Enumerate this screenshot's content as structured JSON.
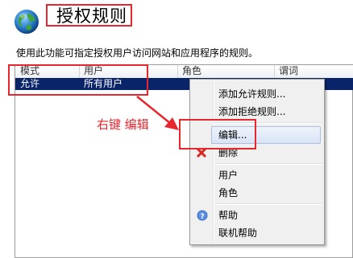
{
  "header": {
    "title": "授权规则"
  },
  "description": "使用此功能可指定授权用户访问网站和应用程序的规则。",
  "grid": {
    "columns": [
      "模式",
      "用户",
      "角色",
      "谓词"
    ],
    "rows": [
      {
        "mode": "允许",
        "users": "所有用户",
        "roles": "",
        "verbs": ""
      }
    ]
  },
  "annotation": {
    "text": "右键 编辑"
  },
  "context_menu": {
    "items": [
      {
        "label": "添加允许规则..."
      },
      {
        "label": "添加拒绝规则..."
      },
      {
        "label": "编辑..."
      },
      {
        "label": "删除"
      },
      {
        "label": "用户"
      },
      {
        "label": "角色"
      },
      {
        "label": "帮助"
      },
      {
        "label": "联机帮助"
      }
    ],
    "highlighted": "编辑..."
  },
  "colors": {
    "annotation_red": "#e8262e",
    "selection_blue": "#0a246a",
    "menu_bg": "#f0f0f0"
  },
  "icons": [
    "globe-icon",
    "delete-icon",
    "help-icon"
  ]
}
